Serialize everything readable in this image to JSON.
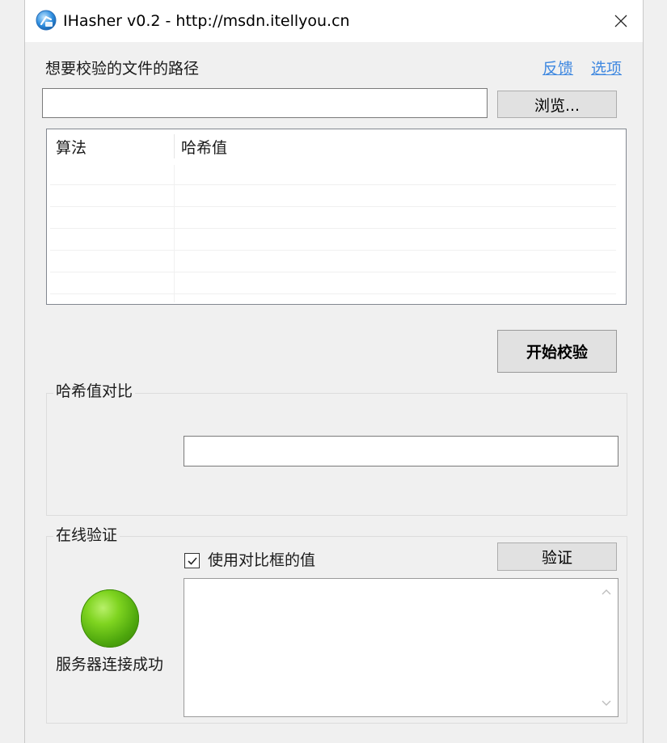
{
  "window": {
    "title": "IHasher v0.2 - http://msdn.itellyou.cn"
  },
  "file_section": {
    "path_label": "想要校验的文件的路径",
    "feedback_link": "反馈",
    "options_link": "选项",
    "path_value": "",
    "browse_button": "浏览..."
  },
  "result_list": {
    "columns": [
      "算法",
      "哈希值"
    ],
    "rows": []
  },
  "start_button": "开始校验",
  "compare_group": {
    "title": "哈希值对比",
    "compare_value": ""
  },
  "online_group": {
    "title": "在线验证",
    "use_compare_checkbox_label": "使用对比框的值",
    "use_compare_checked": true,
    "verify_button": "验证",
    "result_text": "",
    "server_status": "服务器连接成功",
    "status_color": "#5bb514"
  }
}
